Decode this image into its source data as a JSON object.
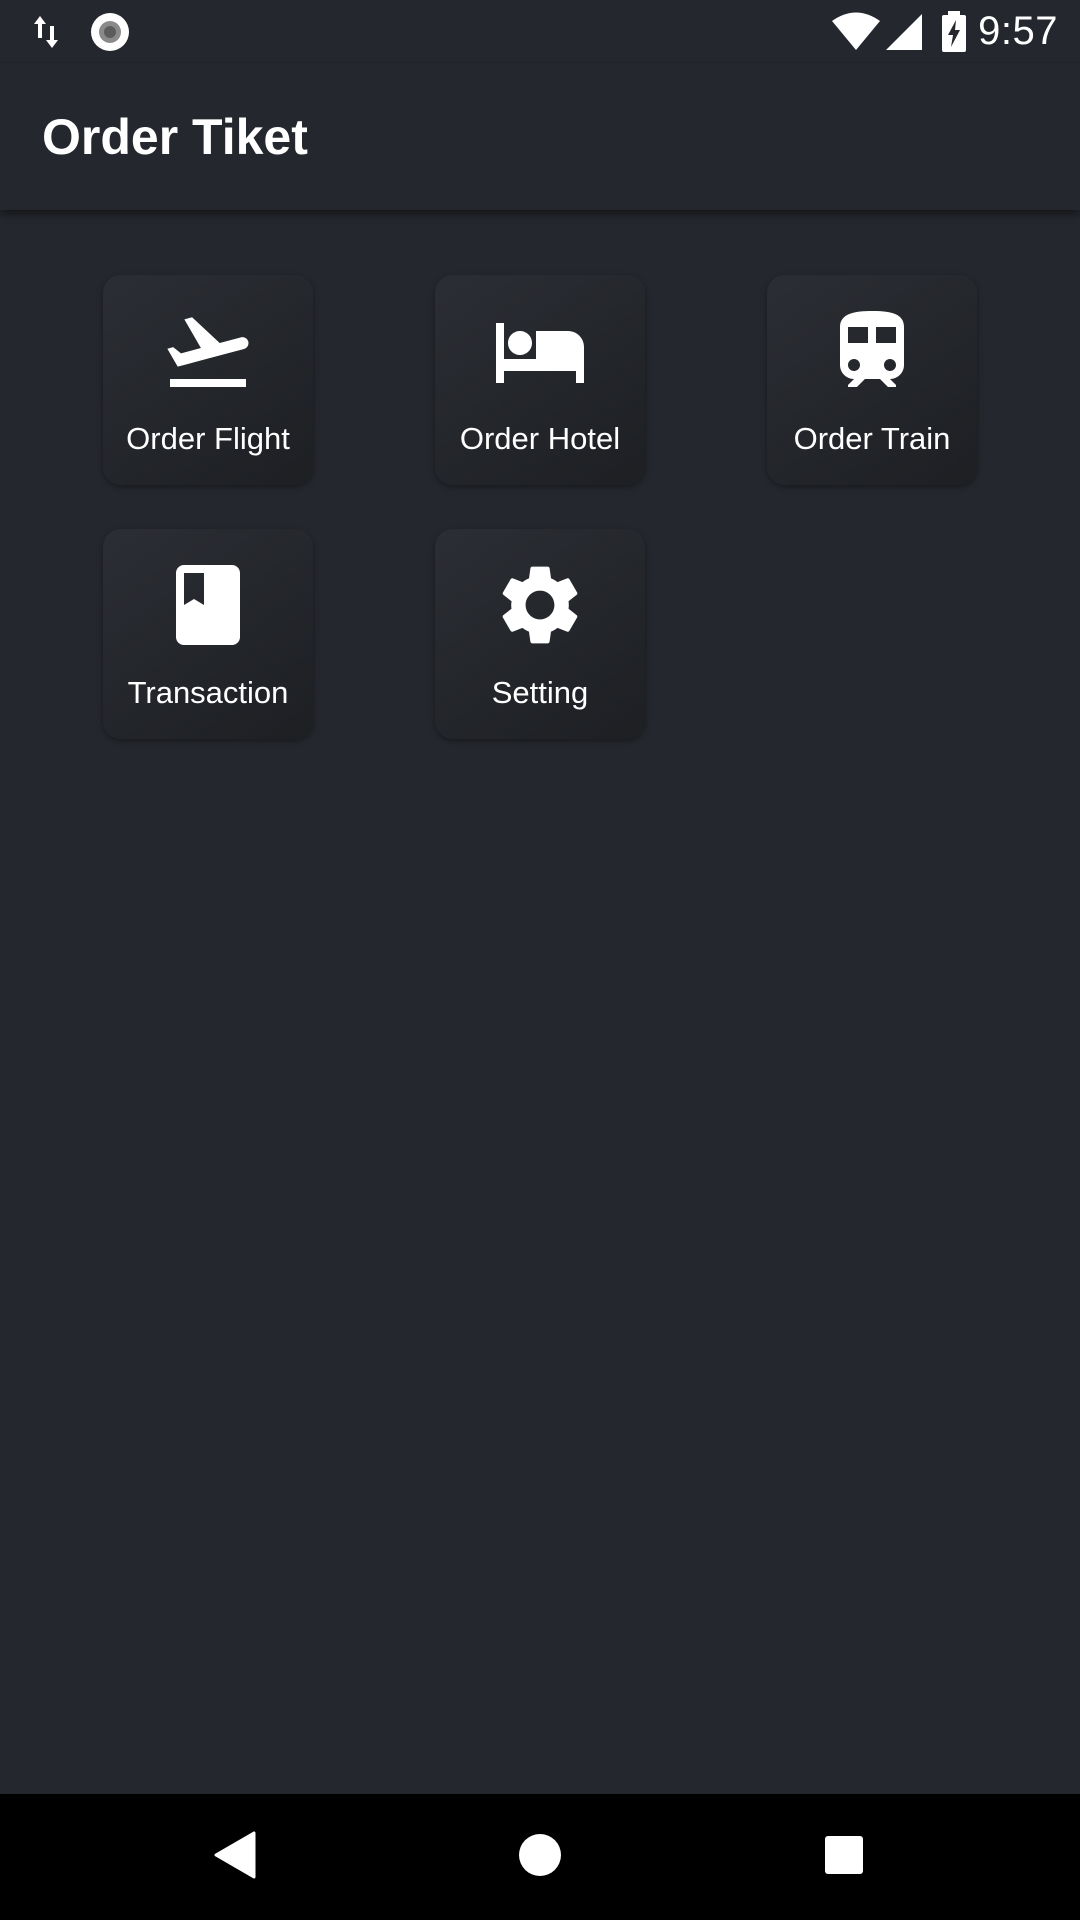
{
  "status_bar": {
    "time": "9:57",
    "icons": [
      "data-transfer-icon",
      "record-icon",
      "wifi-icon",
      "cell-signal-icon",
      "battery-charging-icon"
    ]
  },
  "app_bar": {
    "title": "Order Tiket"
  },
  "menu": {
    "items": [
      {
        "label": "Order Flight",
        "icon": "flight-takeoff-icon"
      },
      {
        "label": "Order Hotel",
        "icon": "hotel-bed-icon"
      },
      {
        "label": "Order Train",
        "icon": "train-icon"
      },
      {
        "label": "Transaction",
        "icon": "book-icon"
      },
      {
        "label": "Setting",
        "icon": "gear-icon"
      }
    ]
  },
  "nav_bar": {
    "icons": [
      "back-icon",
      "home-icon",
      "recents-icon"
    ]
  },
  "colors": {
    "background": "#24272d",
    "tile_light": "#2b2e34",
    "tile_dark": "#1d1f23",
    "text": "#ffffff",
    "nav_background": "#000000"
  }
}
